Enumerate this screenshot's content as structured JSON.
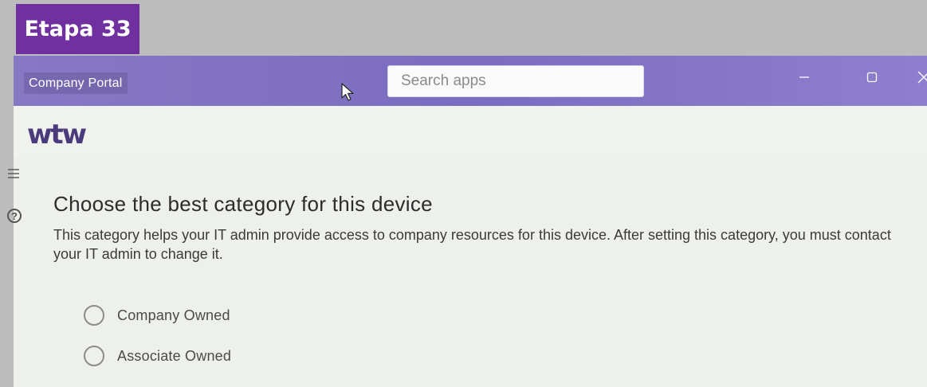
{
  "overlay": {
    "step_label": "Etapa 33",
    "bg_color": "#7030a0"
  },
  "window": {
    "title": "Company Portal",
    "search": {
      "placeholder": "Search apps",
      "value": ""
    },
    "controls": [
      "minimize-icon",
      "maximize-icon",
      "close-icon"
    ],
    "accent_color": "#7c6cc0"
  },
  "brand": {
    "logo_text": "wtw",
    "logo_color": "#4b3a7c"
  },
  "sidebar": {
    "icons": [
      "hamburger-icon",
      "help-icon"
    ],
    "help_glyph": "?"
  },
  "main": {
    "heading": "Choose the best category for this device",
    "description": "This category helps your IT admin provide access to company resources for this device. After setting this category, you must contact your IT admin to change it.",
    "options": [
      {
        "label": "Company Owned",
        "selected": false
      },
      {
        "label": "Associate Owned",
        "selected": false
      }
    ]
  }
}
